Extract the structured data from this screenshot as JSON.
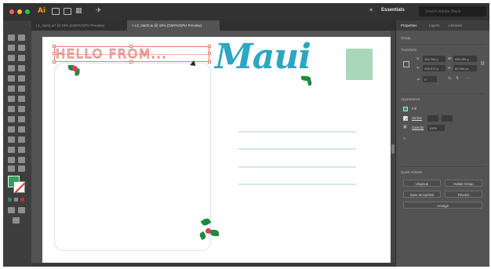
{
  "app": {
    "logo": "Ai",
    "workspace": "Essentials",
    "search_placeholder": "Search Adobe Stock",
    "colors": {
      "brand": "#ff9a00",
      "close": "#ff5f57",
      "minimize": "#ffbd2e",
      "maximize": "#28c840",
      "selection": "#ea7b6c",
      "fill": "#27a35a",
      "stroke_none": "#e0312b"
    }
  },
  "menubar": {
    "icons": [
      "document-icon",
      "bridge-icon",
      "arrange-icon",
      "send-icon"
    ],
    "glyphs": {
      "arrange": "▦",
      "send": "✈",
      "light": "☀"
    }
  },
  "tabs": [
    {
      "label": "L1_start1.ai* @ 33% (CMYK/GPU Preview)",
      "active": false
    },
    {
      "label": "×  L2_start2.ai @ 43% (CMYK/GPU Preview)",
      "active": true
    }
  ],
  "artboard": {
    "hello_text": "HELLO FROM...",
    "title_text": "Maui"
  },
  "panel": {
    "tabs": [
      "Properties",
      "Layers",
      "Libraries"
    ],
    "group_label": "Group",
    "transform_label": "Transform",
    "x_label": "X:",
    "x_value": "102.784 p",
    "w_label": "W:",
    "w_value": "950.455 p",
    "y_label": "Y:",
    "y_value": "208.573 p",
    "h_label": "H:",
    "h_value": "62.364 px",
    "angle_label": "⊿:",
    "angle_value": "0°",
    "appearance_label": "Appearance",
    "fill_label": "Fill",
    "stroke_label": "Stroke",
    "opacity_label": "Opacity",
    "opacity_value": "100%",
    "fx_label": "fx.",
    "quick_actions_label": "Quick Actions",
    "buttons": {
      "ungroup": "Ungroup",
      "isolate": "Isolate Group",
      "save_symbol": "Save as Symbol",
      "recolor": "Recolor",
      "arrange": "Arrange"
    }
  }
}
